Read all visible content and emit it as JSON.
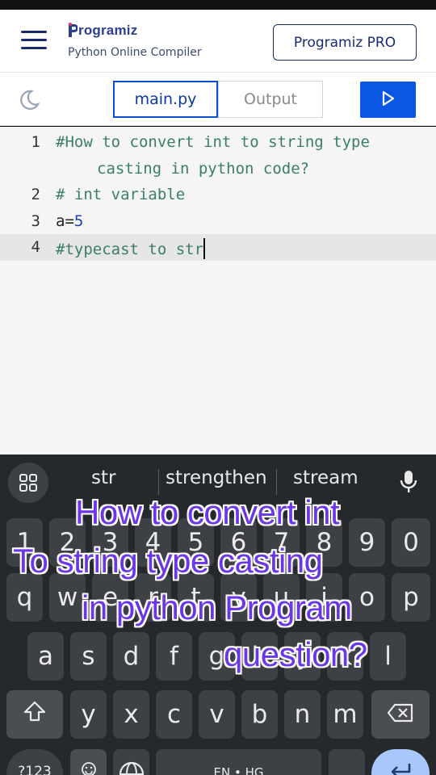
{
  "header": {
    "logo_text": "rogramiz",
    "subtitle": "Python Online Compiler",
    "pro_label": "Programiz PRO"
  },
  "toolbar": {
    "tab_main": "main.py",
    "tab_output": "Output"
  },
  "editor": {
    "lines": [
      {
        "number": "1",
        "text": "#How to convert int to string type",
        "text_cont": "casting in python code?"
      },
      {
        "number": "2",
        "text": "# int variable"
      },
      {
        "number": "3",
        "text_a": "a=",
        "text_b": "5"
      },
      {
        "number": "4",
        "text": "#typecast to str"
      }
    ]
  },
  "keyboard": {
    "suggestions": [
      "str",
      "strengthen",
      "stream"
    ],
    "row_numbers": [
      "1",
      "2",
      "3",
      "4",
      "5",
      "6",
      "7",
      "8",
      "9",
      "0"
    ],
    "row1": [
      "q",
      "w",
      "e",
      "r",
      "t",
      "y",
      "u",
      "i",
      "o",
      "p"
    ],
    "row2": [
      "a",
      "s",
      "d",
      "f",
      "g",
      "h",
      "j",
      "k",
      "l"
    ],
    "row3": [
      "y",
      "x",
      "c",
      "v",
      "b",
      "n",
      "m"
    ],
    "symbols_key": "?123",
    "space_label": "EN • HG"
  },
  "overlay": {
    "line1": "How to convert int",
    "line2": "To string  type casting",
    "line3": "in python Program",
    "line4": "question?"
  },
  "colors": {
    "brand_navy": "#1a2a6c",
    "run_blue": "#0b57e3",
    "comment_green": "#3b7f62",
    "overlay_purple": "#6a36e8"
  }
}
